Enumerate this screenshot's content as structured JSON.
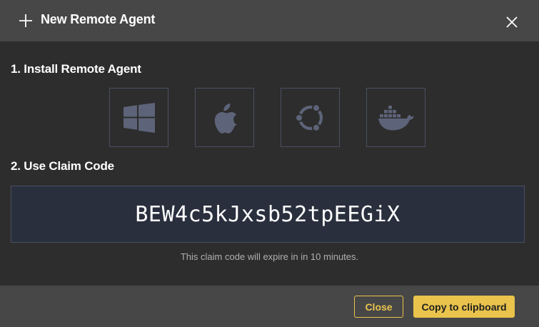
{
  "header": {
    "title": "New Remote Agent",
    "plus_icon": "plus-icon",
    "close_icon": "close-icon"
  },
  "install": {
    "heading": "1. Install Remote Agent",
    "platforms": [
      {
        "name": "Windows",
        "icon": "windows-icon"
      },
      {
        "name": "macOS",
        "icon": "apple-icon"
      },
      {
        "name": "Ubuntu",
        "icon": "ubuntu-icon"
      },
      {
        "name": "Docker",
        "icon": "docker-icon"
      }
    ]
  },
  "claim": {
    "heading": "2. Use Claim Code",
    "code": "BEW4c5kJxsb52tpEEGiX",
    "note": "This claim code will expire in in 10 minutes."
  },
  "footer": {
    "close_label": "Close",
    "copy_label": "Copy to clipboard"
  },
  "colors": {
    "accent": "#e9c34c",
    "header_bg": "#474747",
    "body_bg": "#2d2d2d",
    "code_bg": "#2a2f3e",
    "icon_color": "#5d6378"
  }
}
